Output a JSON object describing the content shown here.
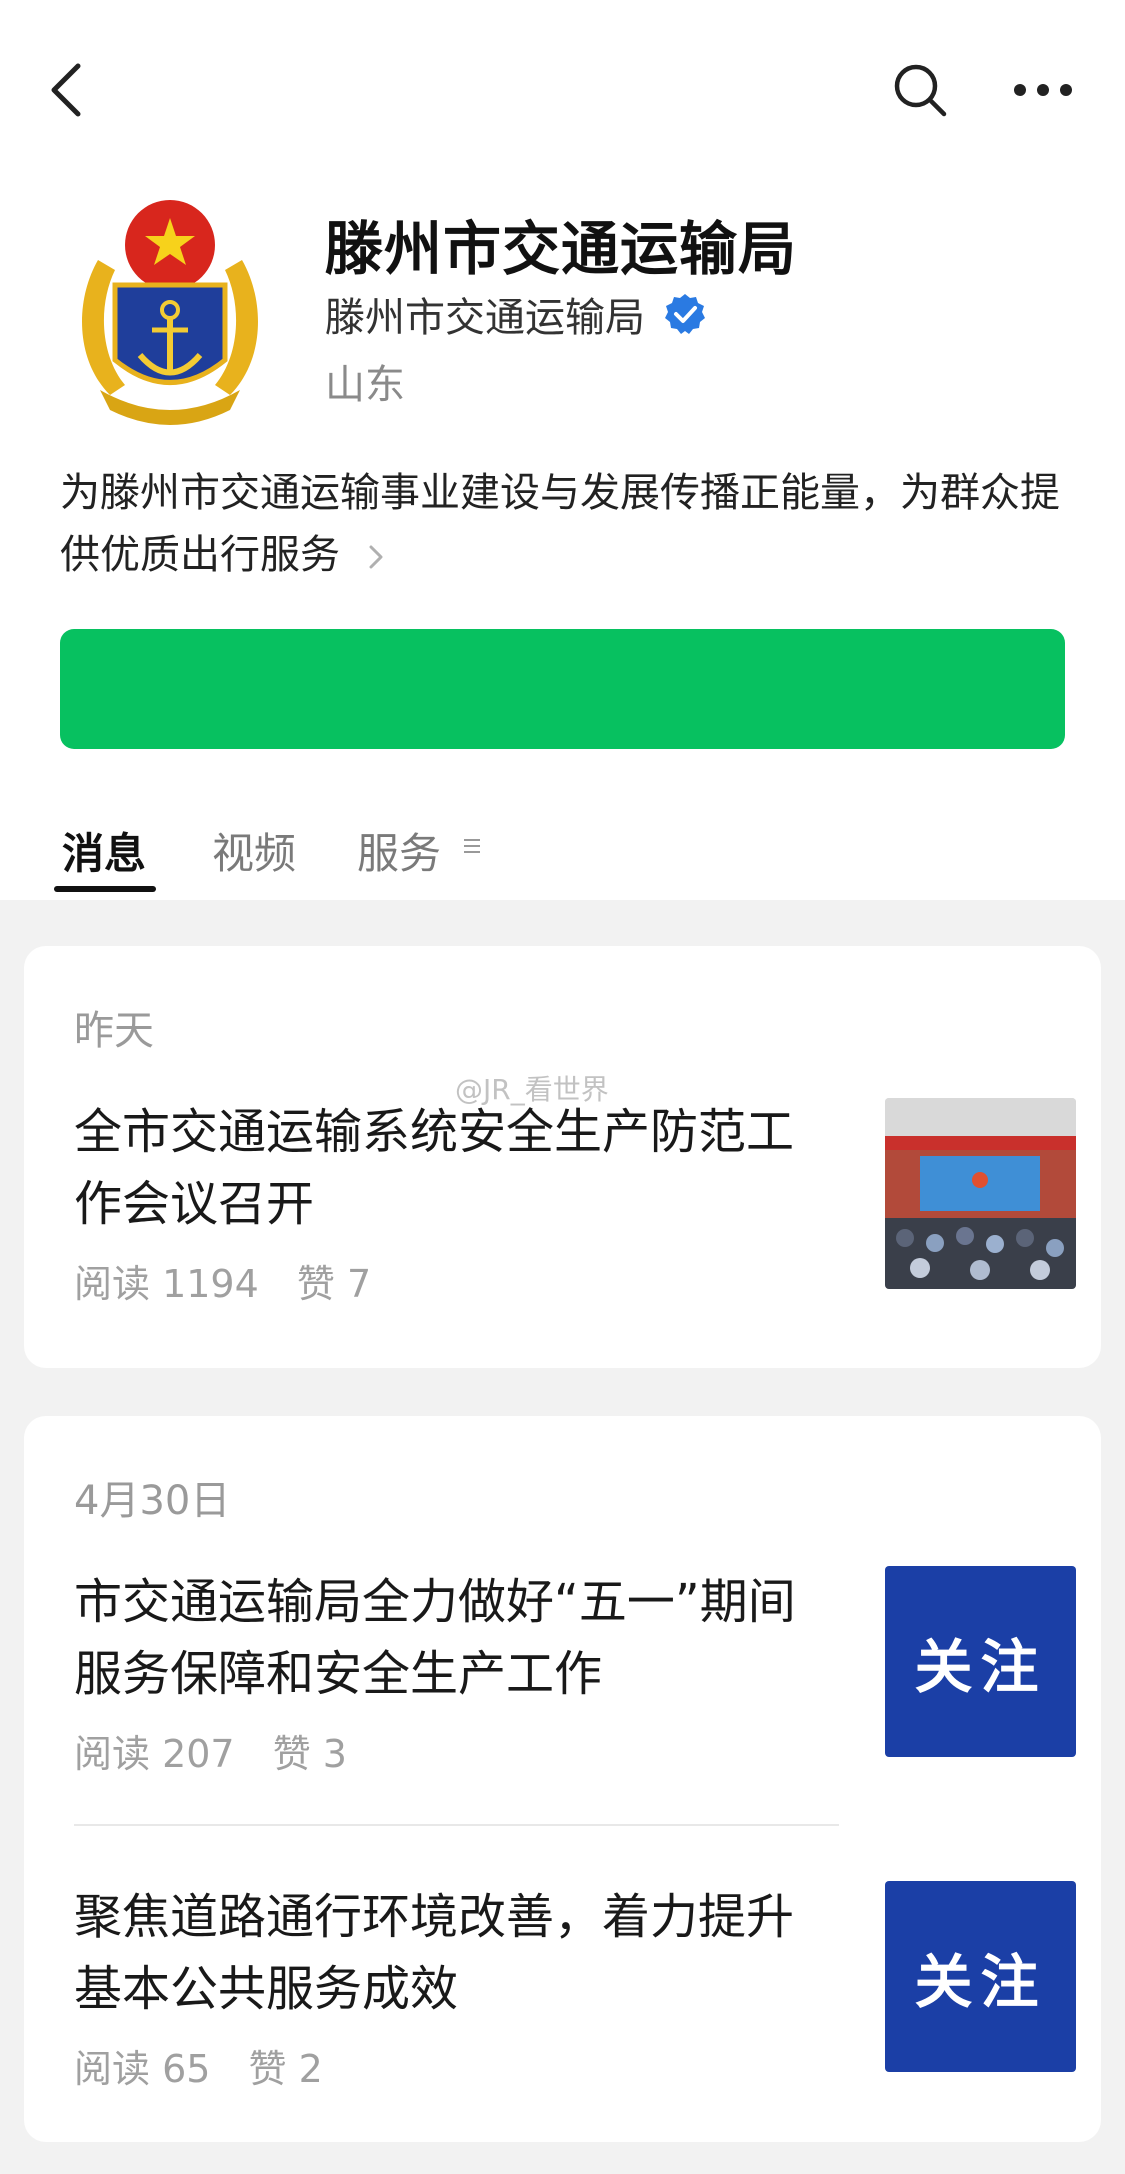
{
  "account": {
    "name": "滕州市交通运输局",
    "verified_name": "滕州市交通运输局",
    "region": "山东",
    "description": "为滕州市交通运输事业建设与发展传播正能量，为群众提供优质出行服务"
  },
  "follow_button": {
    "label": ""
  },
  "tabs": [
    {
      "label": "消息"
    },
    {
      "label": "视频"
    },
    {
      "label": "服务"
    }
  ],
  "cards": [
    {
      "date": "昨天",
      "items": [
        {
          "title": "全市交通运输系统安全生产防范工作会议召开",
          "reads": "阅读 1194",
          "likes": "赞 7",
          "thumb": "meeting-photo"
        }
      ]
    },
    {
      "date": "4月30日",
      "items": [
        {
          "title": "市交通运输局全力做好“五一”期间服务保障和安全生产工作",
          "reads": "阅读 207",
          "likes": "赞 3",
          "thumb_text": "关注"
        },
        {
          "title": "聚焦道路通行环境改善，着力提升基本公共服务成效",
          "reads": "阅读 65",
          "likes": "赞 2",
          "thumb_text": "关注"
        }
      ]
    }
  ],
  "watermark": "@JR_看世界",
  "colors": {
    "follow_green": "#07c160",
    "verify_blue": "#2a7ae2",
    "thumb_blue": "#1b3fa6"
  },
  "icons": [
    "back-arrow-icon",
    "search-icon",
    "more-icon",
    "verified-icon",
    "chevron-right-icon",
    "menu-lines-icon"
  ]
}
